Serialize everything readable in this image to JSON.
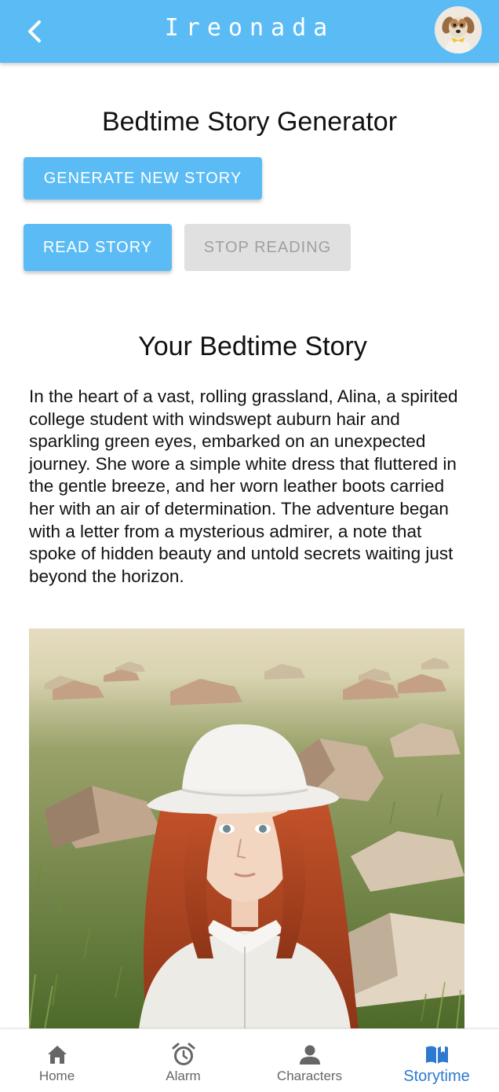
{
  "header": {
    "title": "Ireonada",
    "back_icon": "chevron-left-icon",
    "avatar_icon": "puppy-avatar-icon",
    "color": "#5bbcf5"
  },
  "generator": {
    "title": "Bedtime Story Generator",
    "generate_label": "GENERATE NEW STORY",
    "read_label": "READ STORY",
    "stop_label": "STOP READING"
  },
  "story": {
    "title": "Your Bedtime Story",
    "text": "In the heart of a vast, rolling grassland, Alina, a spirited college student with windswept auburn hair and sparkling green eyes, embarked on an unexpected journey. She wore a simple white dress that fluttered in the gentle breeze, and her worn leather boots carried her with an air of determination. The adventure began with a letter from a mysterious admirer, a note that spoke of hidden beauty and untold secrets waiting just beyond the horizon.",
    "image_icon": "story-illustration"
  },
  "nav": {
    "items": [
      {
        "label": "Home",
        "icon": "home-icon"
      },
      {
        "label": "Alarm",
        "icon": "alarm-clock-icon"
      },
      {
        "label": "Characters",
        "icon": "person-icon"
      },
      {
        "label": "Storytime",
        "icon": "open-book-icon"
      }
    ],
    "active_index": 3,
    "active_color": "#2d79d0",
    "inactive_color": "#666666"
  }
}
